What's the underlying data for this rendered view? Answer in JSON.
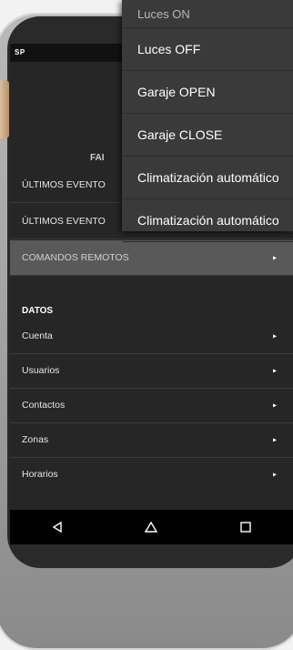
{
  "statusbar": {
    "brand": "SP"
  },
  "favorites": {
    "title": "FAI",
    "items": [
      {
        "label": "ÚLTIMOS EVENTO"
      },
      {
        "label": "ÚLTIMOS EVENTO"
      },
      {
        "label": "COMANDOS REMOTOS"
      }
    ]
  },
  "datos": {
    "title": "DATOS",
    "items": [
      {
        "label": "Cuenta"
      },
      {
        "label": "Usuarios"
      },
      {
        "label": "Contactos"
      },
      {
        "label": "Zonas"
      },
      {
        "label": "Horarios"
      }
    ]
  },
  "popup": {
    "items": [
      {
        "label": "Luces ON"
      },
      {
        "label": "Luces OFF"
      },
      {
        "label": "Garaje OPEN"
      },
      {
        "label": "Garaje CLOSE"
      },
      {
        "label": "Climatización automático"
      },
      {
        "label": "Climatización automático"
      }
    ]
  },
  "colors": {
    "selected_bg": "#595959",
    "menu_bg": "#3a3a3a",
    "screen_bg": "#262626"
  },
  "icons": {
    "row_arrow": "chevron-right-icon",
    "back": "back-triangle-icon",
    "home": "home-icon",
    "recent": "recent-apps-icon"
  }
}
